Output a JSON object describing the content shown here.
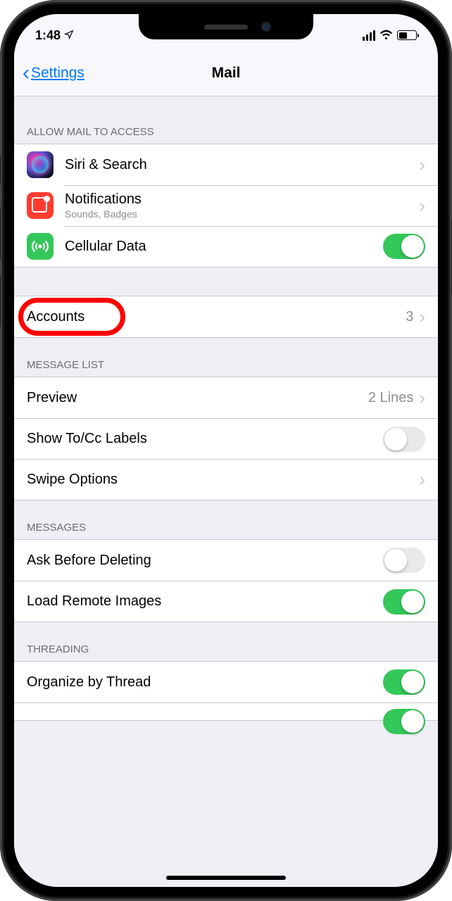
{
  "statusBar": {
    "time": "1:48"
  },
  "header": {
    "backLabel": "Settings",
    "title": "Mail"
  },
  "sections": {
    "allowAccess": {
      "header": "ALLOW MAIL TO ACCESS"
    },
    "siri": {
      "title": "Siri & Search"
    },
    "notifications": {
      "title": "Notifications",
      "subtitle": "Sounds, Badges"
    },
    "cellular": {
      "title": "Cellular Data",
      "enabled": true
    },
    "accounts": {
      "title": "Accounts",
      "count": "3"
    },
    "messageList": {
      "header": "MESSAGE LIST"
    },
    "preview": {
      "title": "Preview",
      "detail": "2 Lines"
    },
    "showToCc": {
      "title": "Show To/Cc Labels",
      "enabled": false
    },
    "swipeOptions": {
      "title": "Swipe Options"
    },
    "messages": {
      "header": "MESSAGES"
    },
    "askDelete": {
      "title": "Ask Before Deleting",
      "enabled": false
    },
    "loadRemote": {
      "title": "Load Remote Images",
      "enabled": true
    },
    "threading": {
      "header": "THREADING"
    },
    "organizeThread": {
      "title": "Organize by Thread",
      "enabled": true
    }
  }
}
